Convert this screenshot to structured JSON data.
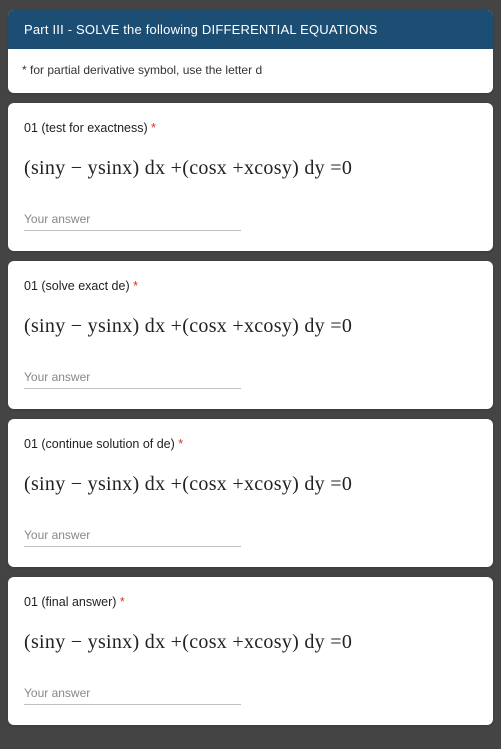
{
  "header": {
    "title": "Part III - SOLVE the following DIFFERENTIAL EQUATIONS"
  },
  "note": {
    "text": "* for partial derivative symbol, use the letter d"
  },
  "required_mark": "*",
  "answer_placeholder": "Your answer",
  "questions": [
    {
      "title": "01 (test for exactness)",
      "equation": "(siny − ysinx) dx +(cosx +xcosy) dy =0"
    },
    {
      "title": "01 (solve exact de)",
      "equation": "(siny − ysinx) dx +(cosx +xcosy) dy =0"
    },
    {
      "title": "01 (continue solution of de)",
      "equation": "(siny − ysinx) dx +(cosx +xcosy) dy =0"
    },
    {
      "title": "01 (final answer)",
      "equation": "(siny − ysinx) dx +(cosx +xcosy) dy =0"
    }
  ]
}
